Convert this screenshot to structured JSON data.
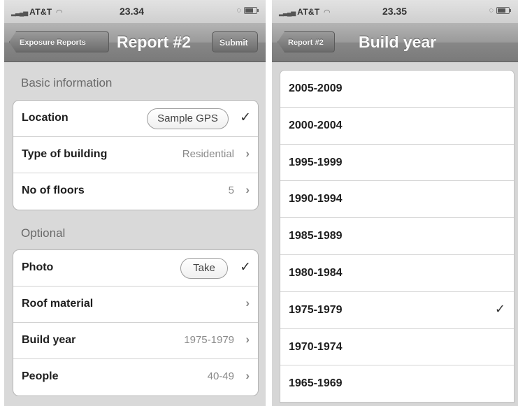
{
  "left": {
    "status": {
      "carrier": "AT&T",
      "time": "23.34"
    },
    "nav": {
      "back_label": "Exposure Reports",
      "title": "Report #2",
      "submit_label": "Submit"
    },
    "sections": [
      {
        "header": "Basic information",
        "rows": [
          {
            "label": "Location",
            "button": "Sample GPS",
            "accessory": "check"
          },
          {
            "label": "Type of building",
            "value": "Residential",
            "accessory": "chevron"
          },
          {
            "label": "No of floors",
            "value": "5",
            "accessory": "chevron"
          }
        ]
      },
      {
        "header": "Optional",
        "rows": [
          {
            "label": "Photo",
            "button": "Take",
            "accessory": "check"
          },
          {
            "label": "Roof material",
            "value": "",
            "accessory": "chevron"
          },
          {
            "label": "Build year",
            "value": "1975-1979",
            "accessory": "chevron"
          },
          {
            "label": "People",
            "value": "40-49",
            "accessory": "chevron"
          }
        ]
      }
    ]
  },
  "right": {
    "status": {
      "carrier": "AT&T",
      "time": "23.35"
    },
    "nav": {
      "back_label": "Report #2",
      "title": "Build year"
    },
    "options": [
      "2005-2009",
      "2000-2004",
      "1995-1999",
      "1990-1994",
      "1985-1989",
      "1980-1984",
      "1975-1979",
      "1970-1974",
      "1965-1969"
    ],
    "selected": "1975-1979"
  },
  "icons": {
    "signal": "signal-bars-icon",
    "wifi": "wifi-icon",
    "battery": "battery-icon",
    "chevron": "chevron-right-icon",
    "check": "checkmark-icon"
  }
}
